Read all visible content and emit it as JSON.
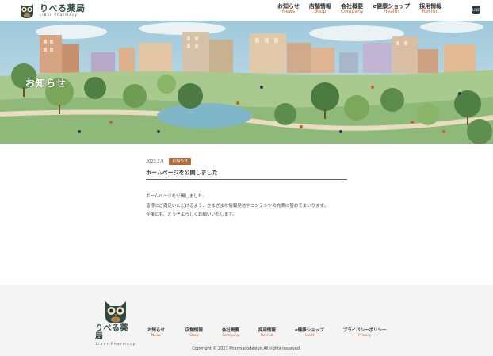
{
  "header": {
    "logo": {
      "jp": "りべる薬局",
      "en": "Liber Pharmacy"
    },
    "nav": [
      {
        "jp": "お知らせ",
        "en": "News"
      },
      {
        "jp": "店舗情報",
        "en": "Shop"
      },
      {
        "jp": "会社概要",
        "en": "Company"
      },
      {
        "jp": "e健康ショップ",
        "en": "Health"
      },
      {
        "jp": "採用情報",
        "en": "Recruit"
      }
    ],
    "line_icon": {
      "label": "LINE",
      "icon": "line-icon"
    }
  },
  "hero": {
    "title": "お知らせ"
  },
  "article": {
    "date": "2023.1.9",
    "badge": "お知らせ",
    "title": "ホームページを公開しました",
    "body": [
      "ホームページを公開しました。",
      "皆様にご満足いただけるよう、さまざまな情報発信やコンテンツの充実に努めてまいります。",
      "今後とも、どうぞよろしくお願いいたします。"
    ]
  },
  "footer": {
    "logo": {
      "jp": "りべる薬局",
      "en": "Liber Pharmacy"
    },
    "nav": [
      {
        "jp": "お知らせ",
        "en": "News"
      },
      {
        "jp": "店舗情報",
        "en": "Shop"
      },
      {
        "jp": "会社概要",
        "en": "Company"
      },
      {
        "jp": "採用情報",
        "en": "Recruit"
      },
      {
        "jp": "e健康ショップ",
        "en": "Health"
      },
      {
        "jp": "プライバシーポリシー",
        "en": "Privacy"
      }
    ],
    "copyright": "Copyright © 2023 Pharmacodesign All rights reserved."
  },
  "colors": {
    "accent": "#c0662f",
    "brand": "#2c4a3e",
    "badge": "#b06a3a",
    "footer_bg": "#f4f4f4"
  }
}
